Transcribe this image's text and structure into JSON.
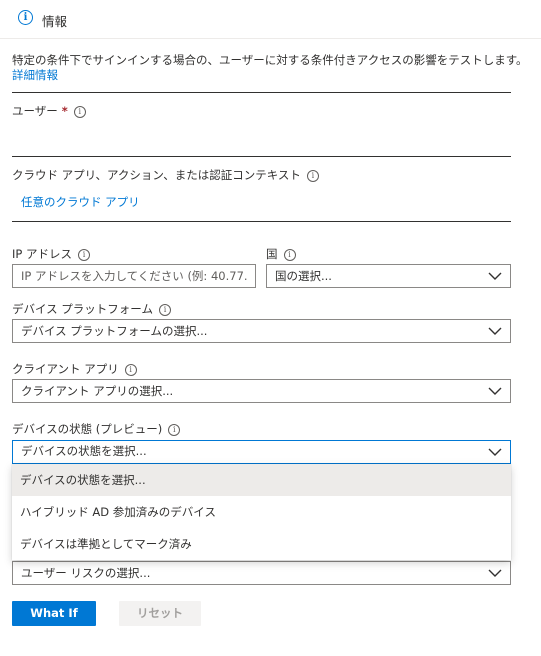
{
  "tab": {
    "label": "情報"
  },
  "description": {
    "text": "特定の条件下でサインインする場合の、ユーザーに対する条件付きアクセスの影響をテストします。",
    "link": "詳細情報"
  },
  "user": {
    "label": "ユーザー",
    "required_mark": "*"
  },
  "cloud_apps": {
    "label": "クラウド アプリ、アクション、または認証コンテキスト",
    "value": "任意のクラウド アプリ"
  },
  "ip": {
    "label": "IP アドレス",
    "placeholder": "IP アドレスを入力してください (例: 40.77.1..."
  },
  "country": {
    "label": "国",
    "value": "国の選択..."
  },
  "device_platform": {
    "label": "デバイス プラットフォーム",
    "value": "デバイス プラットフォームの選択..."
  },
  "client_app": {
    "label": "クライアント アプリ",
    "value": "クライアント アプリの選択..."
  },
  "device_state": {
    "label": "デバイスの状態 (プレビュー)",
    "value": "デバイスの状態を選択...",
    "options": [
      "デバイスの状態を選択...",
      "ハイブリッド AD 参加済みのデバイス",
      "デバイスは準拠としてマーク済み"
    ]
  },
  "user_risk": {
    "value": "ユーザー リスクの選択..."
  },
  "buttons": {
    "whatif": "What If",
    "reset": "リセット"
  },
  "colors": {
    "accent": "#0078d4",
    "required": "#a4262c"
  }
}
